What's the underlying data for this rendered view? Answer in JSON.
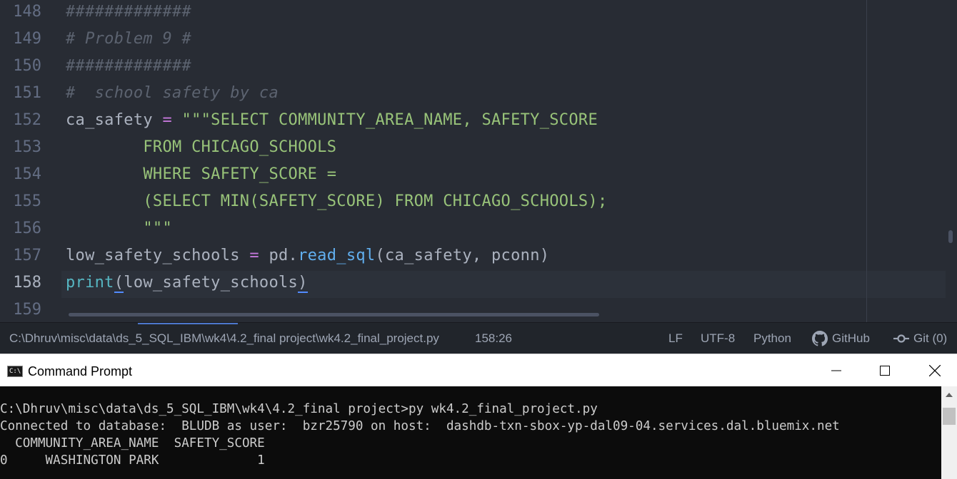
{
  "editor": {
    "lines": [
      {
        "num": "148",
        "tokens": [
          {
            "t": "#############",
            "c": "comment"
          }
        ]
      },
      {
        "num": "149",
        "tokens": [
          {
            "t": "# Problem 9 #",
            "c": "comment"
          }
        ]
      },
      {
        "num": "150",
        "tokens": [
          {
            "t": "#############",
            "c": "comment"
          }
        ]
      },
      {
        "num": "151",
        "tokens": [
          {
            "t": "#  school safety by ca",
            "c": "comment"
          }
        ]
      },
      {
        "num": "152",
        "tokens": [
          {
            "t": "ca_safety ",
            "c": ""
          },
          {
            "t": "=",
            "c": "op"
          },
          {
            "t": " \"\"\"SELECT COMMUNITY_AREA_NAME, SAFETY_SCORE",
            "c": "str"
          }
        ]
      },
      {
        "num": "153",
        "tokens": [
          {
            "t": "        FROM CHICAGO_SCHOOLS",
            "c": "str"
          }
        ]
      },
      {
        "num": "154",
        "tokens": [
          {
            "t": "        WHERE SAFETY_SCORE =",
            "c": "str"
          }
        ]
      },
      {
        "num": "155",
        "tokens": [
          {
            "t": "        (SELECT MIN(SAFETY_SCORE) FROM CHICAGO_SCHOOLS);",
            "c": "str"
          }
        ]
      },
      {
        "num": "156",
        "tokens": [
          {
            "t": "        \"\"\"",
            "c": "str"
          }
        ]
      },
      {
        "num": "157",
        "tokens": [
          {
            "t": "low_safety_schools ",
            "c": ""
          },
          {
            "t": "=",
            "c": "op"
          },
          {
            "t": " pd.",
            "c": ""
          },
          {
            "t": "read_sql",
            "c": "fn"
          },
          {
            "t": "(ca_safety, pconn)",
            "c": ""
          }
        ]
      },
      {
        "num": "158",
        "tokens": [
          {
            "t": "print",
            "c": "builtin"
          },
          {
            "t": "(",
            "c": "bracket-match"
          },
          {
            "t": "low_safety_schools",
            "c": ""
          },
          {
            "t": ")",
            "c": "bracket-match"
          }
        ],
        "current": true
      },
      {
        "num": "159",
        "tokens": []
      }
    ]
  },
  "statusbar": {
    "file_path": "C:\\Dhruv\\misc\\data\\ds_5_SQL_IBM\\wk4\\4.2_final project\\wk4.2_final_project.py",
    "cursor_position": "158:26",
    "line_ending": "LF",
    "encoding": "UTF-8",
    "grammar": "Python",
    "github_label": "GitHub",
    "git_label": "Git (0)"
  },
  "cmd": {
    "title": "Command Prompt",
    "icon_text": "C:\\",
    "lines": [
      "C:\\Dhruv\\misc\\data\\ds_5_SQL_IBM\\wk4\\4.2_final project>py wk4.2_final_project.py",
      "Connected to database:  BLUDB as user:  bzr25790 on host:  dashdb-txn-sbox-yp-dal09-04.services.dal.bluemix.net",
      "  COMMUNITY_AREA_NAME  SAFETY_SCORE",
      "0     WASHINGTON PARK             1"
    ]
  }
}
